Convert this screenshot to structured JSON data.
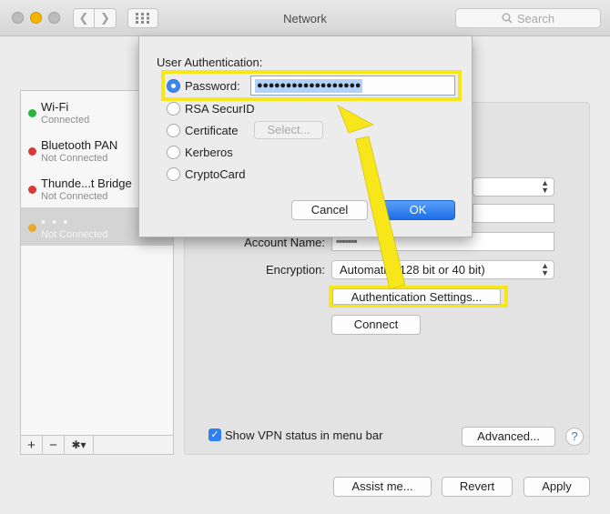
{
  "window": {
    "title": "Network",
    "search_placeholder": "Search"
  },
  "sidebar": {
    "services": [
      {
        "name": "Wi-Fi",
        "status": "Connected",
        "color": "#28b63e"
      },
      {
        "name": "Bluetooth PAN",
        "status": "Not Connected",
        "color": "#d93a33"
      },
      {
        "name": "Thunde...t Bridge",
        "status": "Not Connected",
        "color": "#d93a33"
      },
      {
        "name": "▪ ▪ ▪",
        "status": "Not Connected",
        "color": "#e8a928"
      }
    ],
    "tools": {
      "add": "+",
      "remove": "−",
      "gear": "✱▾"
    }
  },
  "panel": {
    "account_name_label": "Account Name:",
    "account_name_value": "▪▪▪▪▪▪▪",
    "encryption_label": "Encryption:",
    "encryption_value": "Automatic (128 bit or 40 bit)",
    "auth_settings_button": "Authentication Settings...",
    "connect_button": "Connect",
    "show_vpn_label": "Show VPN status in menu bar",
    "advanced_button": "Advanced...",
    "help_button": "?"
  },
  "bottom": {
    "assist_button": "Assist me...",
    "revert_button": "Revert",
    "apply_button": "Apply"
  },
  "sheet": {
    "title": "User Authentication:",
    "options": [
      {
        "label": "Password:",
        "selected": true
      },
      {
        "label": "RSA SecurID",
        "selected": false
      },
      {
        "label": "Certificate",
        "selected": false
      },
      {
        "label": "Kerberos",
        "selected": false
      },
      {
        "label": "CryptoCard",
        "selected": false
      }
    ],
    "password_value": "●●●●●●●●●●●●●●●●●●",
    "select_button": "Select...",
    "cancel_button": "Cancel",
    "ok_button": "OK"
  },
  "colors": {
    "highlight": "#f7e61a",
    "accent": "#2f7ef5"
  }
}
